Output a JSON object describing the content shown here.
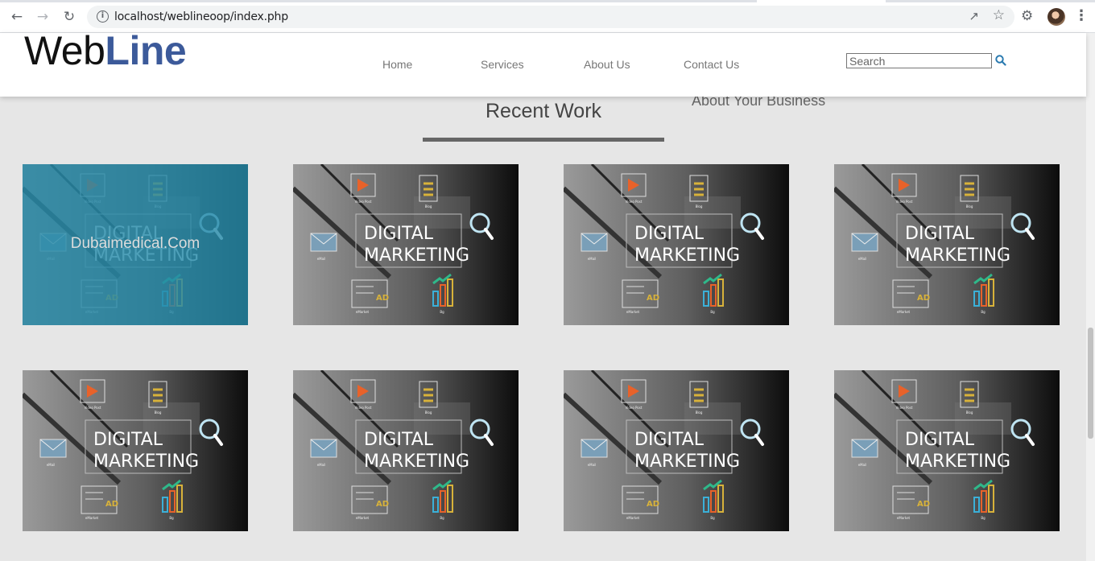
{
  "browser": {
    "url": "localhost/weblineoop/index.php",
    "icons": [
      "back-icon",
      "forward-icon",
      "reload-icon",
      "info-icon",
      "share-icon",
      "star-icon",
      "extensions-icon",
      "avatar",
      "menu-icon"
    ]
  },
  "site": {
    "logo_part1": "Web",
    "logo_part2": "Line",
    "logo_color": "#3c5a9a",
    "nav": [
      "Home",
      "Services",
      "About Us",
      "Contact Us"
    ],
    "search_placeholder": "Search",
    "dropdown_peek": "About Your Business"
  },
  "section": {
    "title": "Recent Work",
    "tiles": [
      {
        "line1": "DIGITAL",
        "line2": "MARKETING",
        "hover_caption": "Dubaimedical.Com",
        "hovered": true
      },
      {
        "line1": "DIGITAL",
        "line2": "MARKETING"
      },
      {
        "line1": "DIGITAL",
        "line2": "MARKETING"
      },
      {
        "line1": "DIGITAL",
        "line2": "MARKETING"
      },
      {
        "line1": "DIGITAL",
        "line2": "MARKETING"
      },
      {
        "line1": "DIGITAL",
        "line2": "MARKETING"
      },
      {
        "line1": "DIGITAL",
        "line2": "MARKETING"
      },
      {
        "line1": "DIGITAL",
        "line2": "MARKETING"
      }
    ],
    "tile_image_labels": {
      "top_left": "Video Post",
      "top_right": "Blog",
      "left": "eMail",
      "bottom_left": "eMarket",
      "bottom_right": "Bg",
      "ad": "AD"
    }
  }
}
